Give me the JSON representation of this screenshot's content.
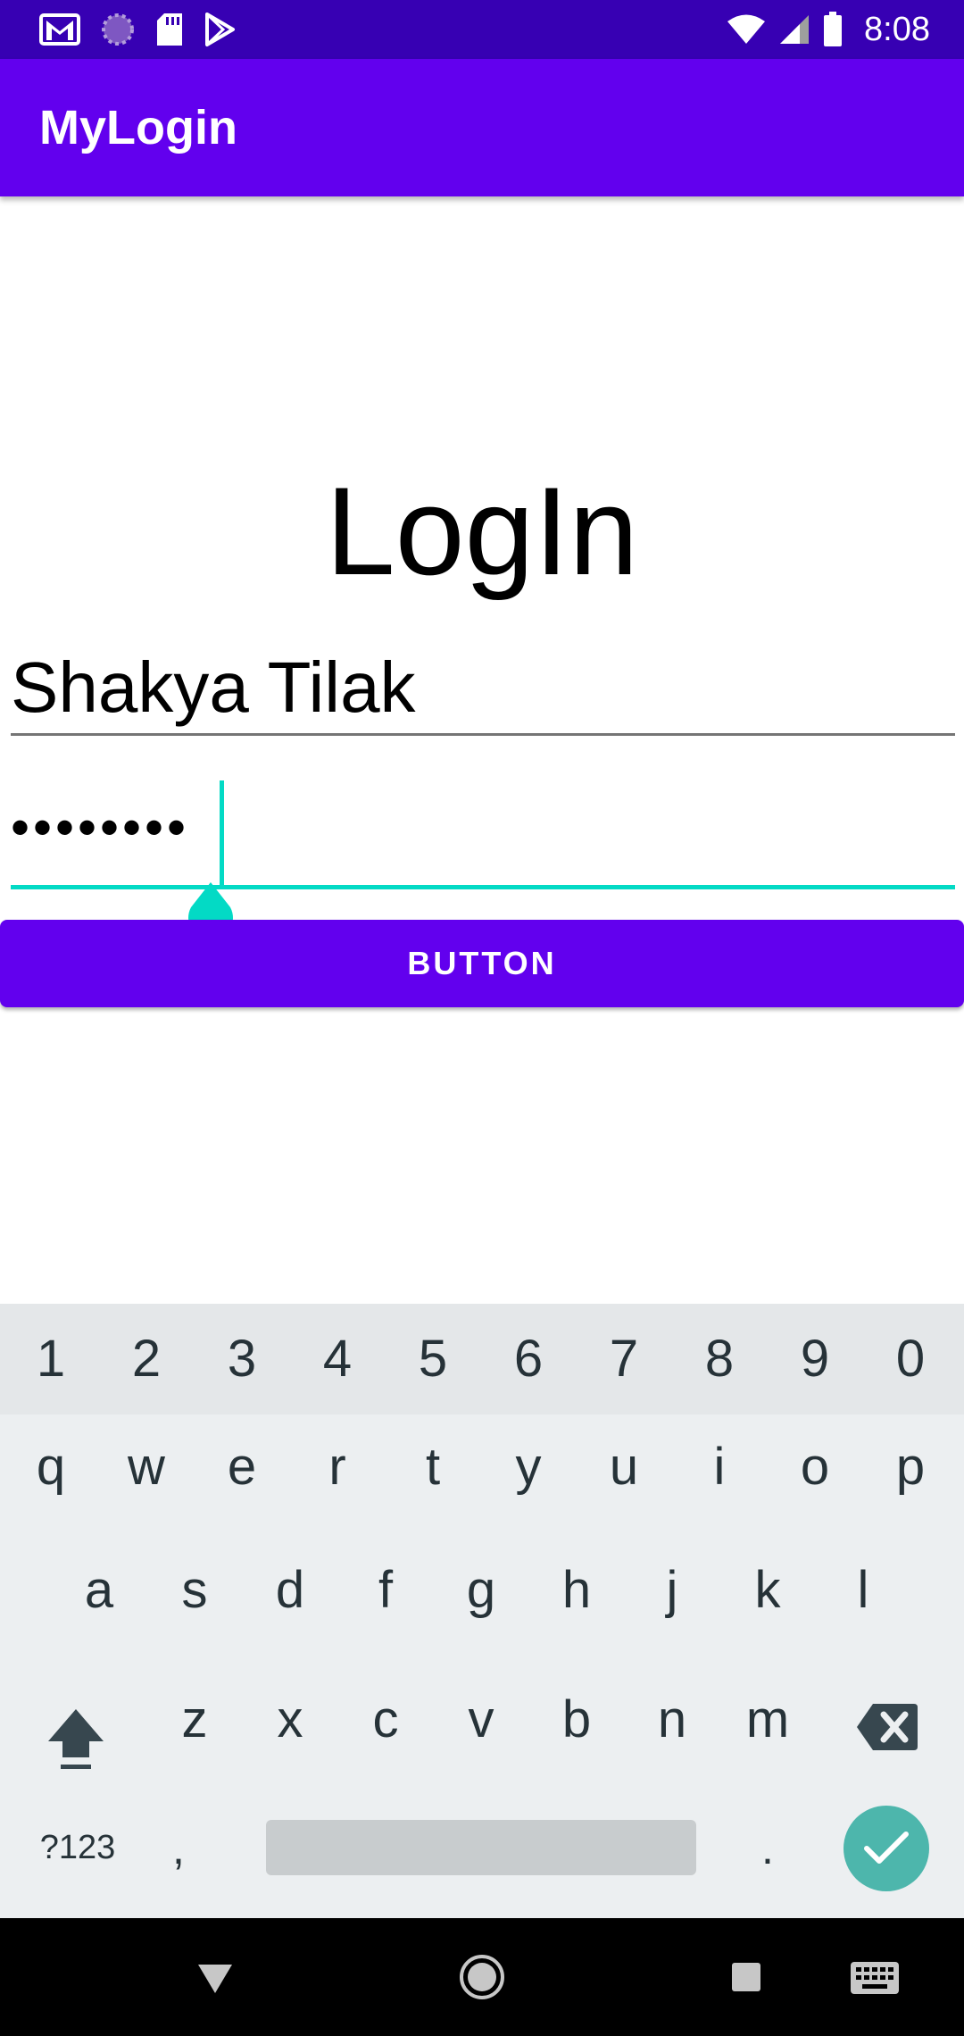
{
  "status_bar": {
    "time": "8:08",
    "left_icons": [
      "gmail-icon",
      "loading-icon",
      "sd-card-icon",
      "play-store-icon"
    ],
    "right_icons": [
      "wifi-icon",
      "signal-icon",
      "battery-icon"
    ]
  },
  "app_bar": {
    "title": "MyLogin"
  },
  "main": {
    "heading": "LogIn",
    "username_value": "Shakya Tilak",
    "password_value": "••••••••",
    "button_label": "BUTTON"
  },
  "keyboard": {
    "number_row": [
      "1",
      "2",
      "3",
      "4",
      "5",
      "6",
      "7",
      "8",
      "9",
      "0"
    ],
    "row1": [
      "q",
      "w",
      "e",
      "r",
      "t",
      "y",
      "u",
      "i",
      "o",
      "p"
    ],
    "row2": [
      "a",
      "s",
      "d",
      "f",
      "g",
      "h",
      "j",
      "k",
      "l"
    ],
    "row3": [
      "z",
      "x",
      "c",
      "v",
      "b",
      "n",
      "m"
    ],
    "symbols_key": "?123",
    "comma_key": ",",
    "period_key": "."
  },
  "colors": {
    "status_bar": "#3700b3",
    "primary": "#6200ee",
    "accent": "#03dac5",
    "enter_key": "#4db6ac"
  }
}
